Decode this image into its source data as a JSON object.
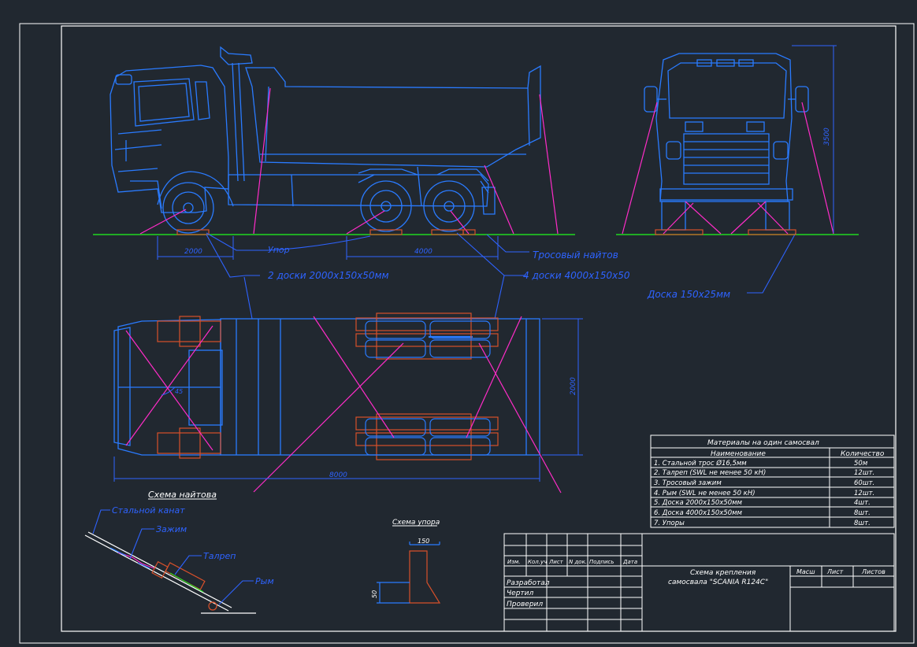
{
  "colors": {
    "background": "#212830",
    "frame": "#ffffff",
    "truck": "#2a7bff",
    "strap": "#ff2cc8",
    "blocks": "#d8502a",
    "ground": "#21d821",
    "callout": "#2e63ff"
  },
  "dims": {
    "side_left": "2000",
    "side_right": "4000",
    "front_height": "3500",
    "plan_width": "2000",
    "plan_length": "8000",
    "plan_angle": "45",
    "stop_width": "150",
    "stop_height": "50"
  },
  "callouts": {
    "stop": "Упор",
    "cable_lashing": "Тросовый найтов",
    "boards_2": "2 доски 2000х150х50мм",
    "boards_4": "4 доски 4000х150х50",
    "board_front": "Доска 150х25мм",
    "steel_cable": "Стальной канат",
    "clamp": "Зажим",
    "turnbuckle": "Талреп",
    "hook": "Рым"
  },
  "titles": {
    "lashing_scheme": "Схема найтова",
    "stop_scheme": "Схема упора"
  },
  "materials": {
    "title": "Материалы на один самосвал",
    "col_name": "Наименование",
    "col_qty": "Количество",
    "rows": [
      {
        "name": "1. Стальной трос Ø16,5мм",
        "qty": "50м"
      },
      {
        "name": "2. Талреп (SWL не менее 50 кН)",
        "qty": "12шт."
      },
      {
        "name": "3. Тросовый зажим",
        "qty": "60шт."
      },
      {
        "name": "4. Рым (SWL не менее 50 кН)",
        "qty": "12шт."
      },
      {
        "name": "5. Доска 2000х150х50мм",
        "qty": "4шт."
      },
      {
        "name": "6. Доска 4000х150х50мм",
        "qty": "8шт."
      },
      {
        "name": "7. Упоры",
        "qty": "8шт."
      }
    ]
  },
  "stamp": {
    "headers": [
      "Изм.",
      "Кол.уч",
      "Лист",
      "N док.",
      "Подпись",
      "Дата"
    ],
    "developed": "Разработал",
    "drew": "Чертил",
    "checked": "Проверил",
    "title_line1": "Схема крепления",
    "title_line2": "самосвала \"SCANIA R124C\"",
    "scale": "Масш",
    "sheet": "Лист",
    "sheets": "Листов"
  }
}
